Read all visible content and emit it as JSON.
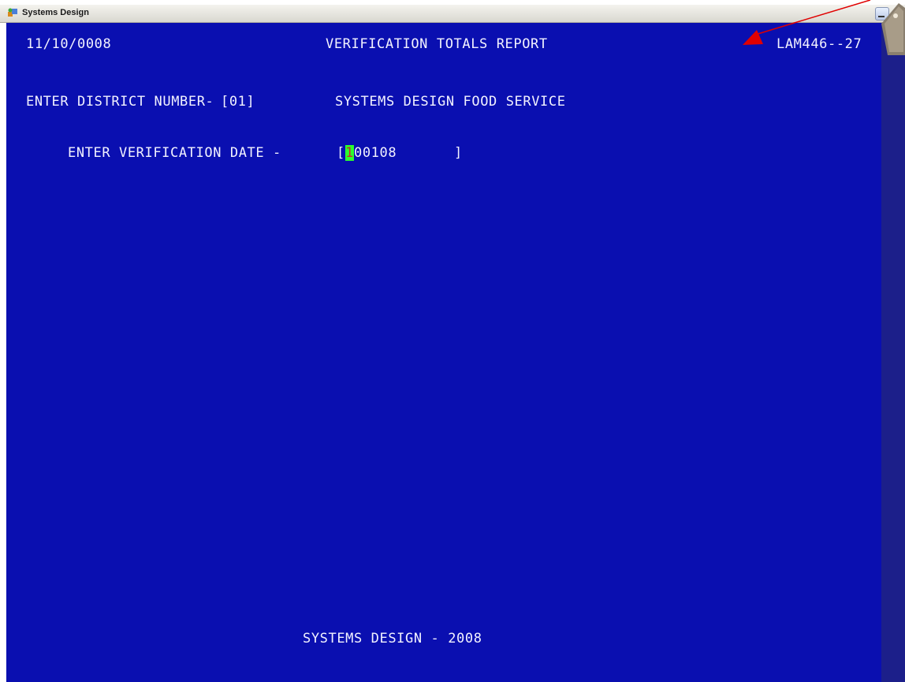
{
  "window": {
    "title": "Systems Design"
  },
  "terminal": {
    "header_date": "11/10/0008",
    "report_title": "VERIFICATION TOTALS REPORT",
    "screen_id": "LAM446--27",
    "district_label": "ENTER DISTRICT NUMBER-",
    "district_value": "[01]",
    "district_name": "SYSTEMS DESIGN FOOD SERVICE",
    "verification_label": "ENTER VERIFICATION DATE -",
    "verification_open": "[",
    "verification_cursor_char": "1",
    "verification_value": "00108",
    "verification_close": "]",
    "footer": "SYSTEMS DESIGN - 2008"
  },
  "colors": {
    "terminal_background": "#0a0fb0",
    "terminal_text": "#f2f2ff",
    "cursor_highlight": "#2cff2c",
    "annotation_arrow": "#e00000"
  },
  "icons": {
    "app": "systems-design-app-icon",
    "annotation": "red-arrow-pointer"
  }
}
